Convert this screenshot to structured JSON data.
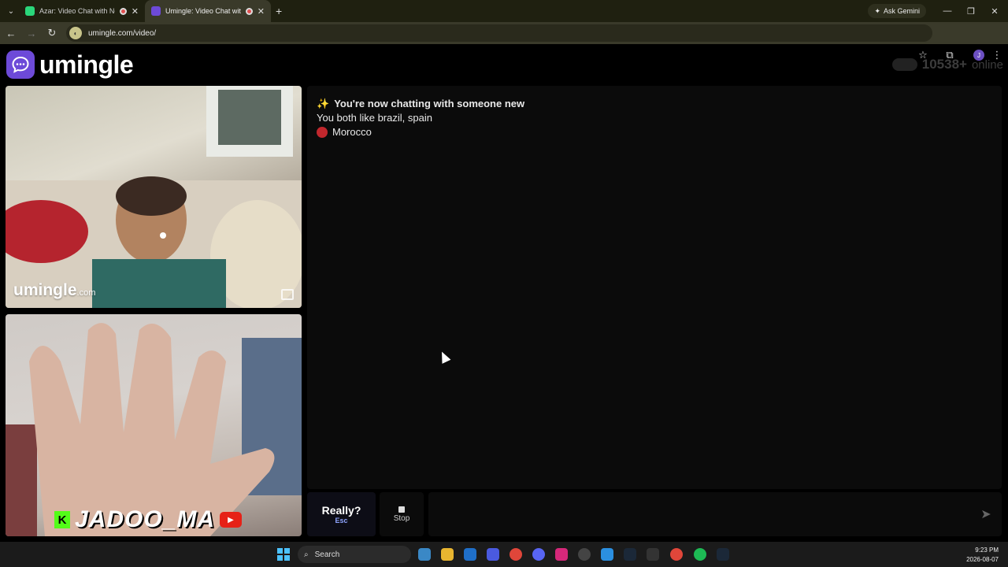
{
  "browser": {
    "tabs": [
      {
        "title": "Azar: Video Chat with New",
        "active": false,
        "favicon_color": "#2ad67b"
      },
      {
        "title": "Umingle: Video Chat with S",
        "active": true,
        "favicon_color": "#6d4ad8"
      }
    ],
    "gemini_label": "Ask Gemini",
    "url": "umingle.com/video/",
    "profile_initial": "J"
  },
  "header": {
    "brand": "umingle",
    "online_count": "10538+",
    "online_label": "online"
  },
  "videos": {
    "stranger_watermark": "umingle",
    "stranger_watermark_suffix": ".com",
    "self_overlay_name": "JADOO_MA",
    "kick_letter": "K"
  },
  "chat": {
    "messages": [
      {
        "icon": "✨",
        "text": "You're now chatting with someone new",
        "bold": true
      },
      {
        "text": "You both like brazil, spain"
      },
      {
        "text": "Morocco",
        "flag_color": "#c1272d"
      }
    ]
  },
  "controls": {
    "next_label": "Really?",
    "next_shortcut": "Esc",
    "stop_label": "Stop",
    "message_placeholder": ""
  },
  "taskbar": {
    "search_label": "Search",
    "time": "9:23 PM",
    "date": "2026-08-07"
  },
  "colors": {
    "brand": "#6d4ad8",
    "accent_text": "#8fa5ff"
  }
}
